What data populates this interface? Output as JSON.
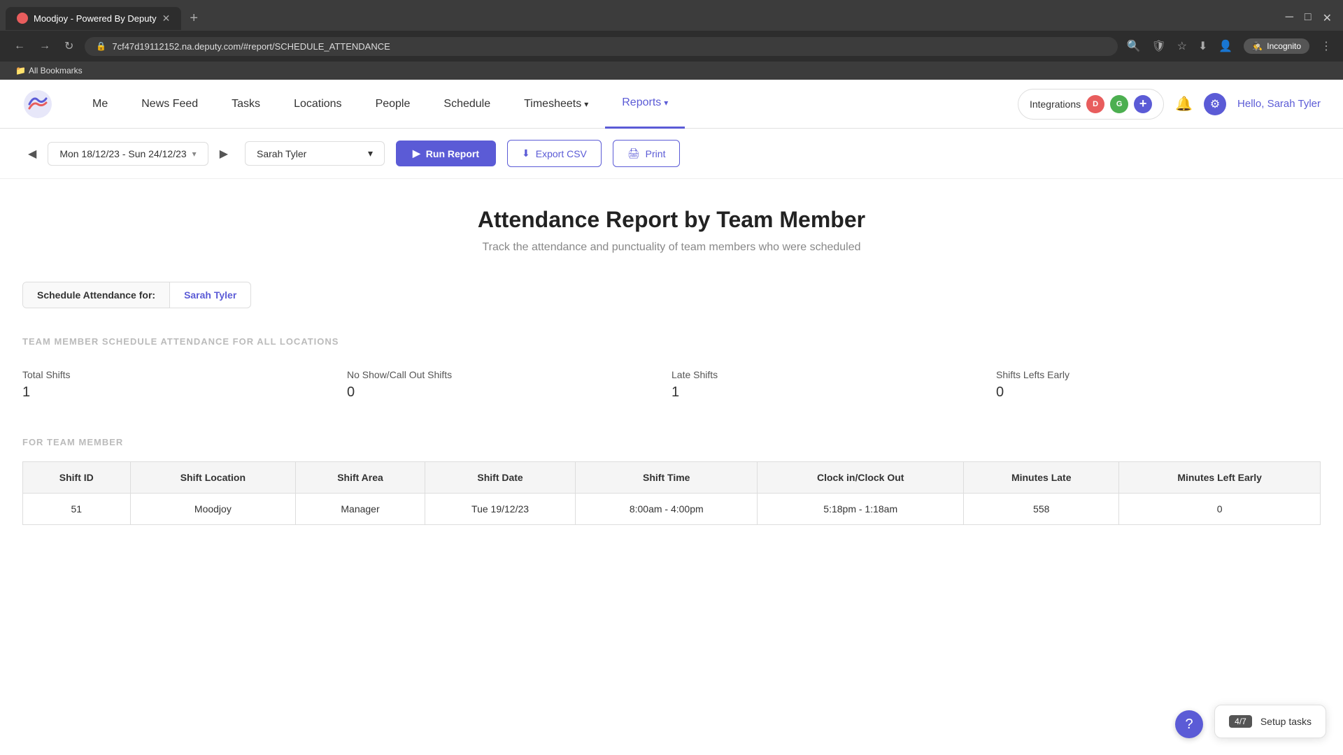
{
  "browser": {
    "tab_title": "Moodjoy - Powered By Deputy",
    "url": "7cf47d19112152.na.deputy.com/#report/SCHEDULE_ATTENDANCE",
    "new_tab_label": "+",
    "incognito_label": "Incognito",
    "bookmarks_label": "All Bookmarks"
  },
  "nav": {
    "me_label": "Me",
    "news_feed_label": "News Feed",
    "tasks_label": "Tasks",
    "locations_label": "Locations",
    "people_label": "People",
    "schedule_label": "Schedule",
    "timesheets_label": "Timesheets",
    "reports_label": "Reports",
    "integrations_label": "Integrations",
    "greeting_prefix": "Hello, ",
    "greeting_name": "Sarah Tyler"
  },
  "toolbar": {
    "prev_label": "◀",
    "next_label": "▶",
    "date_range": "Mon 18/12/23 - Sun 24/12/23",
    "person_value": "Sarah Tyler",
    "run_report_label": "Run Report",
    "export_csv_label": "Export CSV",
    "print_label": "Print"
  },
  "report": {
    "title": "Attendance Report by Team Member",
    "subtitle": "Track the attendance and punctuality of team members who were scheduled",
    "filter_label": "Schedule Attendance for:",
    "filter_value": "Sarah Tyler",
    "all_locations_section": "TEAM MEMBER SCHEDULE ATTENDANCE FOR ALL LOCATIONS",
    "for_member_section": "FOR TEAM MEMBER",
    "stats": [
      {
        "label": "Total Shifts",
        "value": "1"
      },
      {
        "label": "No Show/Call Out Shifts",
        "value": "0"
      },
      {
        "label": "Late Shifts",
        "value": "1"
      },
      {
        "label": "Shifts Lefts Early",
        "value": "0"
      }
    ],
    "table": {
      "headers": [
        "Shift ID",
        "Shift Location",
        "Shift Area",
        "Shift Date",
        "Shift Time",
        "Clock in/Clock Out",
        "Minutes Late",
        "Minutes Left Early"
      ],
      "rows": [
        {
          "shift_id": "51",
          "shift_location": "Moodjoy",
          "shift_area": "Manager",
          "shift_date": "Tue 19/12/23",
          "shift_time": "8:00am - 4:00pm",
          "clock_in_out": "5:18pm - 1:18am",
          "minutes_late": "558",
          "minutes_left_early": "0"
        }
      ]
    }
  },
  "setup_tasks": {
    "badge": "4/7",
    "label": "Setup tasks"
  },
  "help": {
    "icon": "?"
  }
}
